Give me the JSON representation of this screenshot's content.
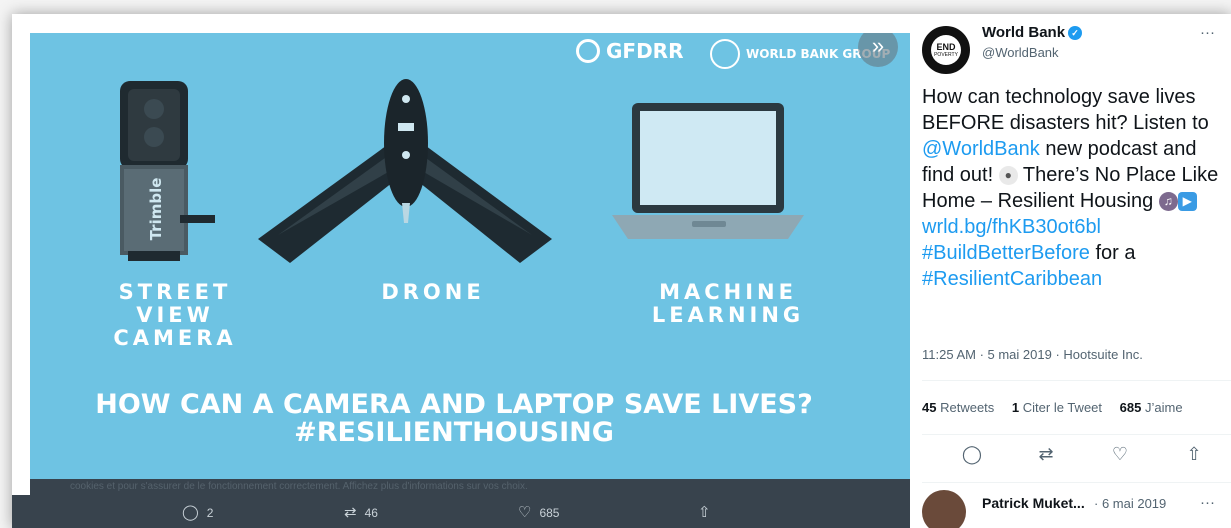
{
  "media": {
    "brand_gfdrr": "GFDRR",
    "brand_wbg": "WORLD BANK GROUP",
    "next_glyph": "»",
    "captions": {
      "camera": "STREET\nVIEW\nCAMERA",
      "drone": "DRONE",
      "ml": "MACHINE\nLEARNING"
    },
    "headline_1": "HOW CAN A CAMERA AND LAPTOP SAVE LIVES?",
    "headline_2": "#RESILIENTHOUSING",
    "device_text": "Trimble",
    "consent_text": "cookies et pour s'assurer de le fonctionnement correctement. Affichez plus d'informations sur vos choix.",
    "actions": {
      "reply_count": "2",
      "retweet_count": "46",
      "like_count": "685"
    },
    "colors": {
      "background": "#6ec3e3",
      "text": "#ffffff"
    }
  },
  "tweet": {
    "author_name": "World Bank",
    "author_handle": "@WorldBank",
    "avatar_line1": "END",
    "avatar_line2": "POVERTY",
    "more": "···",
    "text_plain_1": "How can technology save lives BEFORE disasters hit? Listen to ",
    "mention": "@WorldBank",
    "text_plain_2": " new podcast and find out! ",
    "text_plain_3": " There’s No Place Like Home – Resilient Housing ",
    "link": "wrld.bg/fhKB30ot6bl",
    "hashtag1": "#BuildBetterBefore",
    "text_plain_4": " for a",
    "hashtag2": "#ResilientCaribbean",
    "timestamp": "11:25 AM · 5 mai 2019 · Hootsuite Inc.",
    "stats": {
      "retweets_count": "45",
      "retweets_label": "Retweets",
      "quotes_count": "1",
      "quotes_label": "Citer le Tweet",
      "likes_count": "685",
      "likes_label": "J’aime"
    },
    "icons": {
      "reply": "reply-icon",
      "retweet": "retweet-icon",
      "like": "heart-icon",
      "share": "share-icon",
      "mic": "microphone-emoji",
      "headphones": "headphones-emoji",
      "play": "play-button-emoji"
    },
    "colors": {
      "link": "#1d9bf0",
      "verified": "#1d9bf0"
    }
  },
  "reply": {
    "name": "Patrick Muket...",
    "date": "· 6 mai 2019",
    "more": "···"
  }
}
